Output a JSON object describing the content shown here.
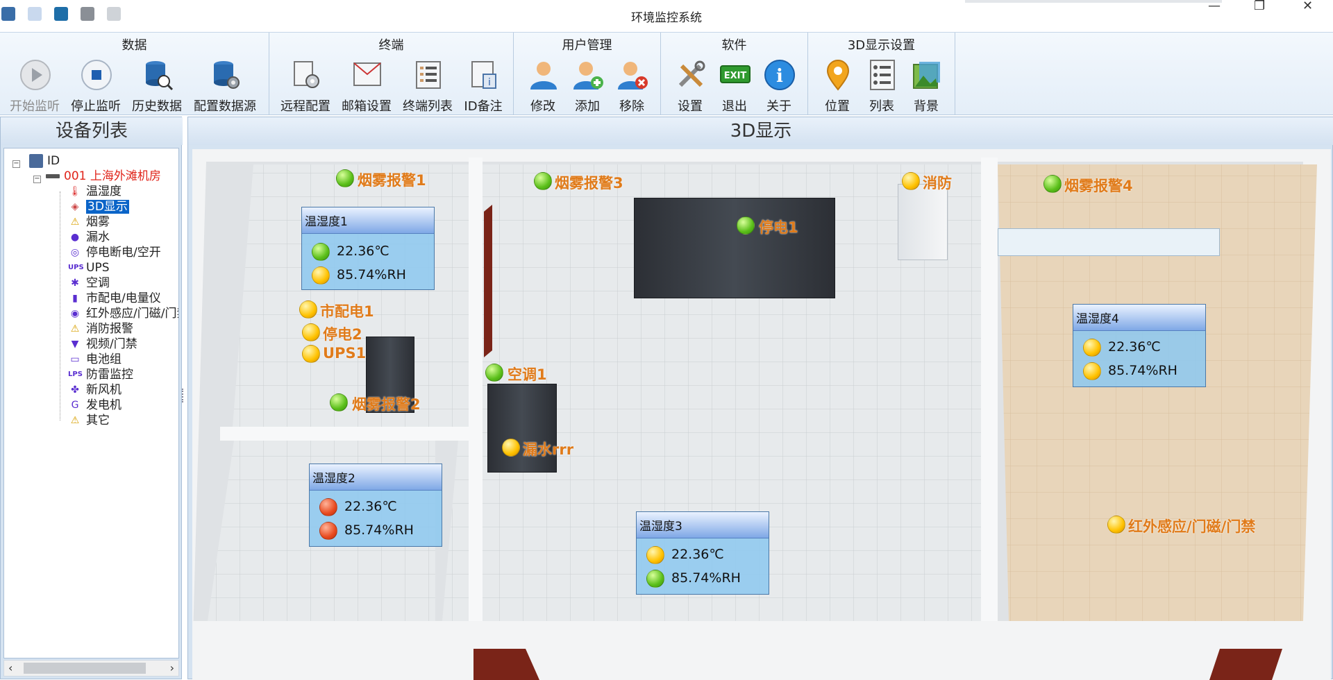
{
  "window": {
    "title": "环境监控系统",
    "controls": [
      "minimize",
      "restore",
      "close"
    ]
  },
  "quick_access": [
    "app-icon",
    "upload-icon",
    "save-icon",
    "grey-box-icon",
    "grey-box-icon"
  ],
  "ribbon": {
    "groups": [
      {
        "title": "数据",
        "buttons": [
          {
            "label": "开始监听",
            "icon": "play-icon",
            "enabled": false
          },
          {
            "label": "停止监听",
            "icon": "stop-icon",
            "enabled": true
          },
          {
            "label": "历史数据",
            "icon": "database-search-icon",
            "enabled": true
          },
          {
            "label": "配置数据源",
            "icon": "database-gear-icon",
            "enabled": true
          }
        ]
      },
      {
        "title": "终端",
        "buttons": [
          {
            "label": "远程配置",
            "icon": "remote-config-icon",
            "enabled": true
          },
          {
            "label": "邮箱设置",
            "icon": "mail-settings-icon",
            "enabled": true
          },
          {
            "label": "终端列表",
            "icon": "list-icon",
            "enabled": true
          },
          {
            "label": "ID备注",
            "icon": "id-note-icon",
            "enabled": true
          }
        ]
      },
      {
        "title": "用户管理",
        "buttons": [
          {
            "label": "修改",
            "icon": "user-edit-icon",
            "enabled": true
          },
          {
            "label": "添加",
            "icon": "user-add-icon",
            "enabled": true
          },
          {
            "label": "移除",
            "icon": "user-remove-icon",
            "enabled": true
          }
        ]
      },
      {
        "title": "软件",
        "buttons": [
          {
            "label": "设置",
            "icon": "tools-icon",
            "enabled": true
          },
          {
            "label": "退出",
            "icon": "exit-icon",
            "enabled": true
          },
          {
            "label": "关于",
            "icon": "info-icon",
            "enabled": true
          }
        ]
      },
      {
        "title": "3D显示设置",
        "buttons": [
          {
            "label": "位置",
            "icon": "location-pin-icon",
            "enabled": true
          },
          {
            "label": "列表",
            "icon": "list-icon",
            "enabled": true
          },
          {
            "label": "背景",
            "icon": "background-icon",
            "enabled": true
          }
        ]
      }
    ]
  },
  "left_panel": {
    "title": "设备列表",
    "root": "ID",
    "site": "001 上海外滩机房",
    "items": [
      "温湿度",
      "3D显示",
      "烟雾",
      "漏水",
      "停电断电/空开",
      "UPS",
      "空调",
      "市配电/电量仪",
      "红外感应/门磁/门禁",
      "消防报警",
      "视频/门禁",
      "电池组",
      "防雷监控",
      "新风机",
      "发电机",
      "其它"
    ],
    "item_icons": [
      "thermometer-icon",
      "3d-cube-icon",
      "warning-icon",
      "water-drop-icon",
      "power-icon",
      "ups-icon",
      "snowflake-icon",
      "meter-icon",
      "infrared-icon",
      "fire-warning-icon",
      "camera-icon",
      "battery-icon",
      "lps-icon",
      "fan-icon",
      "generator-icon",
      "warning-icon"
    ],
    "selected": "3D显示"
  },
  "right_panel": {
    "title": "3D显示",
    "markers": [
      {
        "label": "烟雾报警1",
        "status": "green"
      },
      {
        "label": "烟雾报警3",
        "status": "green"
      },
      {
        "label": "消防",
        "status": "yellow"
      },
      {
        "label": "烟雾报警4",
        "status": "green"
      },
      {
        "label": "停电1",
        "status": "green"
      },
      {
        "label": "市配电1",
        "status": "yellow"
      },
      {
        "label": "停电2",
        "status": "yellow"
      },
      {
        "label": "UPS1",
        "status": "yellow"
      },
      {
        "label": "空调1",
        "status": "green"
      },
      {
        "label": "烟雾报警2",
        "status": "green"
      },
      {
        "label": "漏水rrr",
        "status": "yellow"
      },
      {
        "label": "红外感应/门磁/门禁",
        "status": "yellow"
      }
    ],
    "sensors": [
      {
        "title": "温湿度1",
        "temp": "22.36℃",
        "temp_status": "green",
        "hum": "85.74%RH",
        "hum_status": "yellow"
      },
      {
        "title": "温湿度2",
        "temp": "22.36℃",
        "temp_status": "red",
        "hum": "85.74%RH",
        "hum_status": "red"
      },
      {
        "title": "温湿度3",
        "temp": "22.36℃",
        "temp_status": "yellow",
        "hum": "85.74%RH",
        "hum_status": "green"
      },
      {
        "title": "温湿度4",
        "temp": "22.36℃",
        "temp_status": "yellow",
        "hum": "85.74%RH",
        "hum_status": "yellow"
      }
    ]
  },
  "colors": {
    "marker_label": "#e07b1a",
    "selected_item_bg": "#0a64c8",
    "site_label": "#e0241a",
    "accent": "#7fa8e6"
  }
}
